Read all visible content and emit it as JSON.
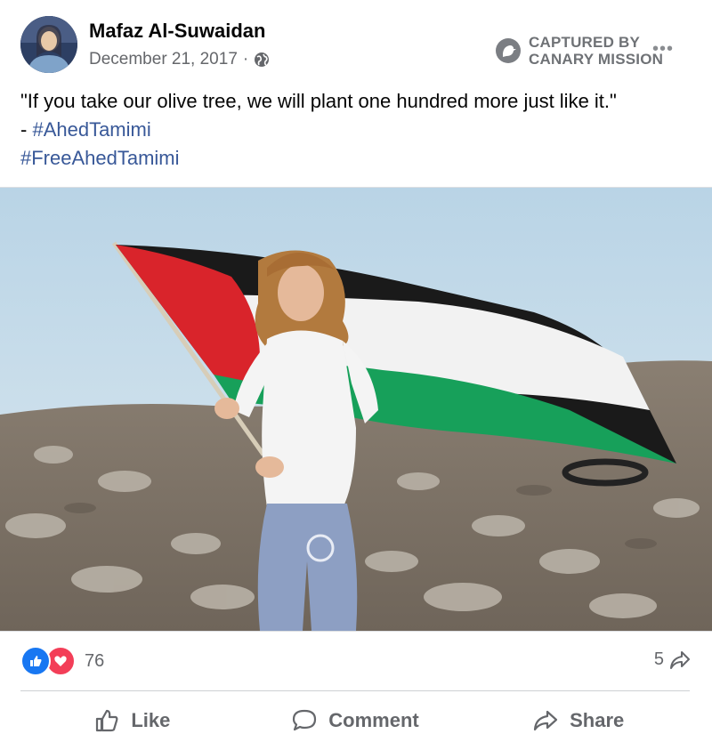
{
  "post": {
    "author": "Mafaz Al-Suwaidan",
    "date": "December 21, 2017",
    "separator": "·",
    "privacy_icon": "globe-icon",
    "watermark": {
      "line1": "CAPTURED BY",
      "line2": "CANARY MISSION"
    },
    "more_icon": "more-options-icon",
    "text_line1": "\"If you take our olive tree, we will plant one hundred more just like it.\"",
    "text_line2_prefix": "- ",
    "hashtag1": "#AhedTamimi",
    "hashtag2": "#FreeAhedTamimi",
    "photo_icon": "photo-flag-girl"
  },
  "engagement": {
    "reaction_count": "76",
    "share_count": "5",
    "reaction_icons": [
      "like-reaction-icon",
      "love-reaction-icon"
    ]
  },
  "actions": {
    "like": "Like",
    "comment": "Comment",
    "share": "Share"
  },
  "colors": {
    "hashtag": "#385898",
    "like_blue": "#1877f2",
    "love_red": "#f33e58",
    "flag_red": "#d9242b",
    "flag_green": "#17a05a"
  }
}
